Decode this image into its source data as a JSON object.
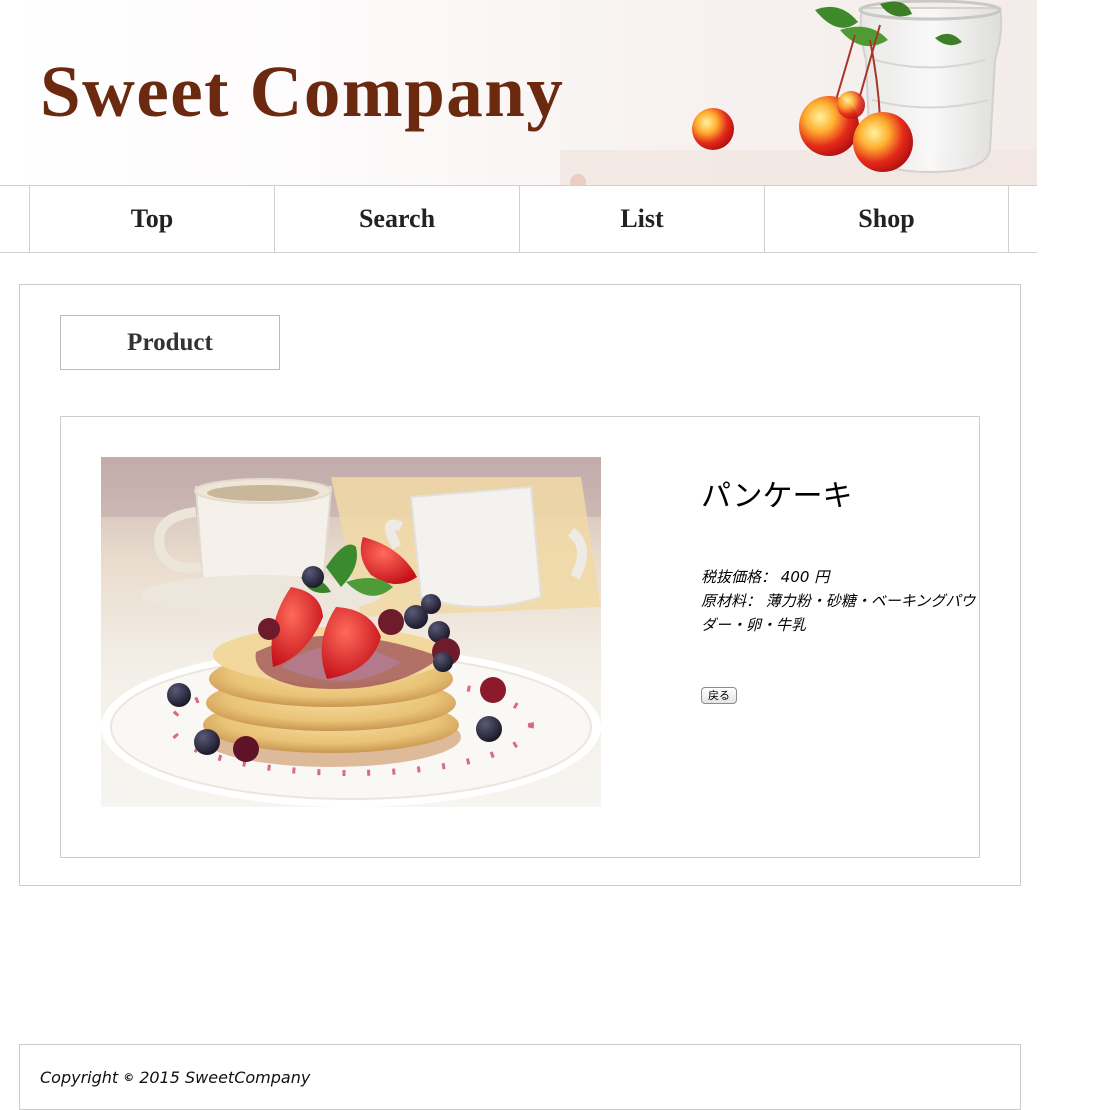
{
  "header": {
    "site_title": "Sweet Company"
  },
  "nav": {
    "items": [
      {
        "label": "Top"
      },
      {
        "label": "Search"
      },
      {
        "label": "List"
      },
      {
        "label": "Shop"
      }
    ]
  },
  "main": {
    "section_title": "Product",
    "product": {
      "name": "パンケーキ",
      "price_label": "税抜価格：",
      "price_value": "400 円",
      "ingredients_label": "原材料：",
      "ingredients_value": "薄力粉・砂糖・ベーキングパウダー・卵・牛乳",
      "back_button_label": "戻る"
    }
  },
  "footer": {
    "copyright_prefix": "Copyright",
    "copyright_symbol": "©",
    "copyright_text": "2015 SweetCompany"
  },
  "colors": {
    "title": "#6b2a10",
    "nav_text": "#222222",
    "border": "#cccccc"
  }
}
